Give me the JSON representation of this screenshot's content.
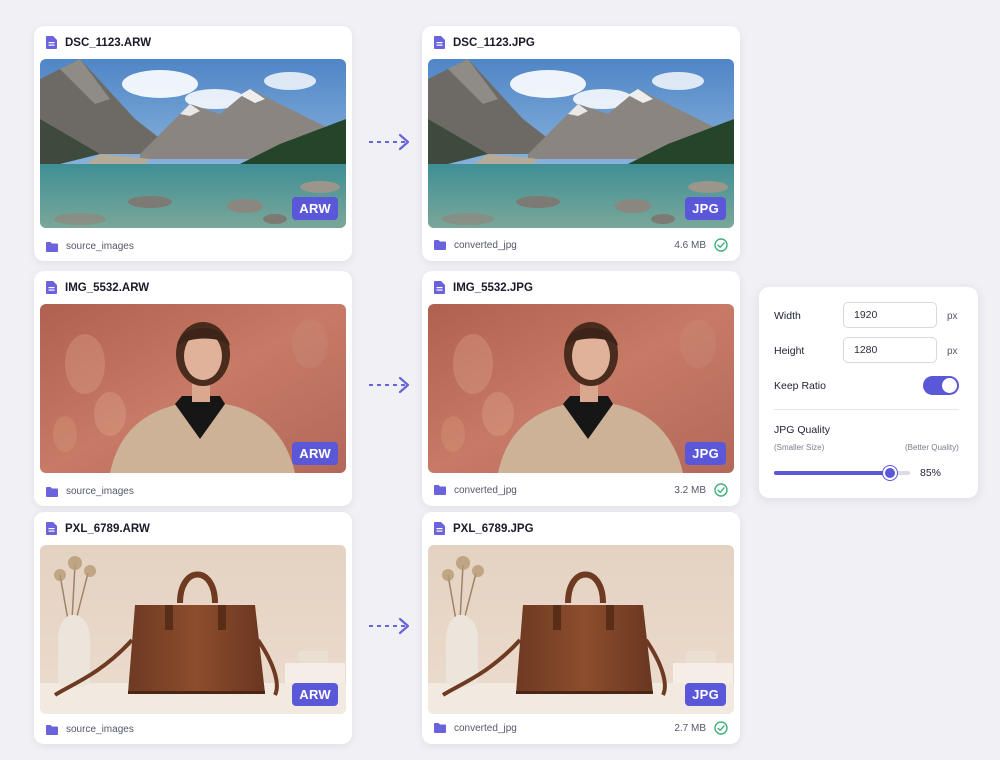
{
  "colors": {
    "accent": "#5b57d9",
    "success": "#3fb07a",
    "icon": "#6a63dc"
  },
  "rows": [
    {
      "source": {
        "filename": "DSC_1123.ARW",
        "badge": "ARW",
        "folder": "source_images",
        "image": "mountain-lake-photo"
      },
      "output": {
        "filename": "DSC_1123.JPG",
        "badge": "JPG",
        "folder": "converted_jpg",
        "size": "4.6 MB",
        "status_icon": "check-circle-icon"
      }
    },
    {
      "source": {
        "filename": "IMG_5532.ARW",
        "badge": "ARW",
        "folder": "source_images",
        "image": "portrait-woman-photo"
      },
      "output": {
        "filename": "IMG_5532.JPG",
        "badge": "JPG",
        "folder": "converted_jpg",
        "size": "3.2 MB",
        "status_icon": "check-circle-icon"
      }
    },
    {
      "source": {
        "filename": "PXL_6789.ARW",
        "badge": "ARW",
        "folder": "source_images",
        "image": "leather-handbag-photo"
      },
      "output": {
        "filename": "PXL_6789.JPG",
        "badge": "JPG",
        "folder": "converted_jpg",
        "size": "2.7 MB",
        "status_icon": "check-circle-icon"
      }
    }
  ],
  "settings": {
    "width_label": "Width",
    "width_value": "1920",
    "height_label": "Height",
    "height_value": "1280",
    "unit": "px",
    "keep_ratio_label": "Keep Ratio",
    "keep_ratio_on": true,
    "quality_label": "JPG Quality",
    "quality_min_label": "(Smaller Size)",
    "quality_max_label": "(Better Quality)",
    "quality_value": 85,
    "quality_display": "85%"
  }
}
